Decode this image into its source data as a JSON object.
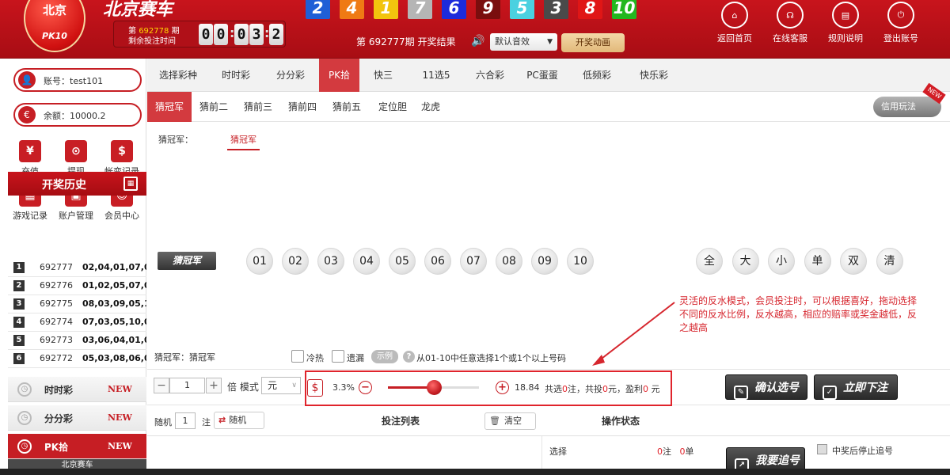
{
  "header": {
    "logo_city": "北京",
    "logo_code": "PK10",
    "app_name": "北京赛车",
    "issue_prefix": "第",
    "issue_number": "692778",
    "issue_suffix": "期",
    "countdown_label": "剩余投注时间",
    "countdown": [
      "0",
      "0",
      "0",
      "3",
      "2",
      "3"
    ],
    "results": [
      {
        "n": "2",
        "c": "#1f5fd6"
      },
      {
        "n": "4",
        "c": "#ef7a14"
      },
      {
        "n": "1",
        "c": "#f2c40e"
      },
      {
        "n": "7",
        "c": "#b5b5b5"
      },
      {
        "n": "6",
        "c": "#1c2bdb"
      },
      {
        "n": "9",
        "c": "#7a0e0e"
      },
      {
        "n": "5",
        "c": "#4bd1e0"
      },
      {
        "n": "3",
        "c": "#4a4a4a"
      },
      {
        "n": "8",
        "c": "#e01616"
      },
      {
        "n": "10",
        "c": "#23b71f"
      }
    ],
    "latest_result": "第 692777期   开奖结果",
    "sound_option": "默认音效",
    "animation_button": "开奖动画",
    "nav": [
      {
        "label": "返回首页",
        "icon": "home-icon",
        "g": "⌂"
      },
      {
        "label": "在线客服",
        "icon": "headset-icon",
        "g": "☊"
      },
      {
        "label": "规则说明",
        "icon": "rules-icon",
        "g": "▤"
      },
      {
        "label": "登出账号",
        "icon": "power-icon",
        "g": "⏻"
      }
    ]
  },
  "sidebar": {
    "account": "账号：test101",
    "balance": "余额：10000.2",
    "actions": [
      {
        "label": "充值",
        "g": "¥"
      },
      {
        "label": "提现",
        "g": "⊙"
      },
      {
        "label": "帐变记录",
        "g": "$"
      },
      {
        "label": "游戏记录",
        "g": "▦"
      },
      {
        "label": "账户管理",
        "g": "▣"
      },
      {
        "label": "会员中心",
        "g": "☺"
      }
    ],
    "history_title": "开奖历史",
    "history": [
      {
        "no": "1",
        "issue": "692777",
        "result": "02,04,01,07,0"
      },
      {
        "no": "2",
        "issue": "692776",
        "result": "01,02,05,07,0"
      },
      {
        "no": "3",
        "issue": "692775",
        "result": "08,03,09,05,1"
      },
      {
        "no": "4",
        "issue": "692774",
        "result": "07,03,05,10,0"
      },
      {
        "no": "5",
        "issue": "692773",
        "result": "03,06,04,01,0"
      },
      {
        "no": "6",
        "issue": "692772",
        "result": "05,03,08,06,0"
      }
    ],
    "games": [
      {
        "name": "时时彩",
        "badge": "NEW"
      },
      {
        "name": "分分彩",
        "badge": "NEW"
      },
      {
        "name": "PK拾",
        "badge": "NEW"
      }
    ],
    "partial_label": "北京赛车"
  },
  "categories": [
    "选择彩种",
    "时时彩",
    "分分彩",
    "PK拾",
    "快三",
    "11选5",
    "六合彩",
    "PC蛋蛋",
    "低频彩",
    "快乐彩"
  ],
  "subtabs": [
    "猜冠军",
    "猜前二",
    "猜前三",
    "猜前四",
    "猜前五",
    "定位胆",
    "龙虎"
  ],
  "credit_label": "信用玩法",
  "new_tag": "NEW",
  "play": {
    "label": "猜冠军：",
    "value": "猜冠军"
  },
  "row_label": "猜冠军",
  "numbers": [
    "01",
    "02",
    "03",
    "04",
    "05",
    "06",
    "07",
    "08",
    "09",
    "10"
  ],
  "quick": [
    "全",
    "大",
    "小",
    "单",
    "双",
    "清"
  ],
  "tip": "灵活的反水模式，会员投注时，可以根据喜好，拖动选择不同的反水比例，反水越高，相应的赔率或奖金越低，反之越高",
  "selection": {
    "label": "猜冠军：猜冠军",
    "cold_hot": "冷热",
    "missing": "遗漏",
    "example": "示例",
    "help": "?",
    "rule": "从01-10中任意选择1个或1个以上号码"
  },
  "bet": {
    "multiplier": "1",
    "unit_label": "倍 模式",
    "mode": "元",
    "rebate_pct": "3.3%",
    "rebate_level": 0.5,
    "odds": "18.84",
    "summary": {
      "p1": "共选",
      "count": "0",
      "p2": "注，共投",
      "amount": "0",
      "p3": "元，盈利",
      "profit": "0",
      "p4": " 元"
    },
    "confirm": "确认选号",
    "place": "立即下注"
  },
  "random": {
    "label": "随机",
    "count": "1",
    "unit": "注",
    "button": "随机"
  },
  "list_title": "投注列表",
  "clear_button": "清空",
  "op_status": "操作状态",
  "bottom": {
    "select": "选择",
    "count": "0",
    "unit1": "注",
    "orders": "0",
    "unit2": "单",
    "chase": "我要追号",
    "stop_label": "中奖后停止追号"
  }
}
